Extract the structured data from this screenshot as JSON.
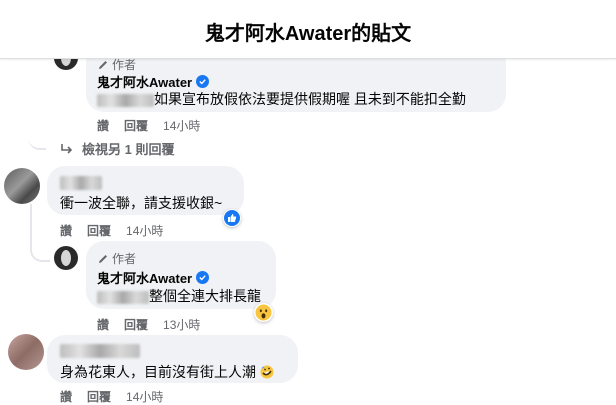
{
  "header": {
    "title": "鬼才阿水Awater的貼文"
  },
  "author_label": "作者",
  "actions": {
    "like": "讚",
    "reply": "回覆"
  },
  "comments": [
    {
      "name": "鬼才阿水Awater",
      "text": "如果宣布放假依法要提供假期喔 且未到不能扣全勤",
      "time": "14小時"
    },
    {
      "view_more": "檢視另 1 則回覆"
    },
    {
      "text": "衝一波全聯，請支援收銀~",
      "time": "14小時",
      "reaction": "like"
    },
    {
      "name": "鬼才阿水Awater",
      "text": "整個全連大排長龍",
      "time": "13小時",
      "reaction": "wow"
    },
    {
      "text": "身為花東人，目前沒有街上人潮",
      "emoji": "rofl",
      "time": "14小時"
    }
  ],
  "colors": {
    "brand": "#1877f2",
    "bubble": "#f0f2f5",
    "secondary": "#65676b"
  }
}
